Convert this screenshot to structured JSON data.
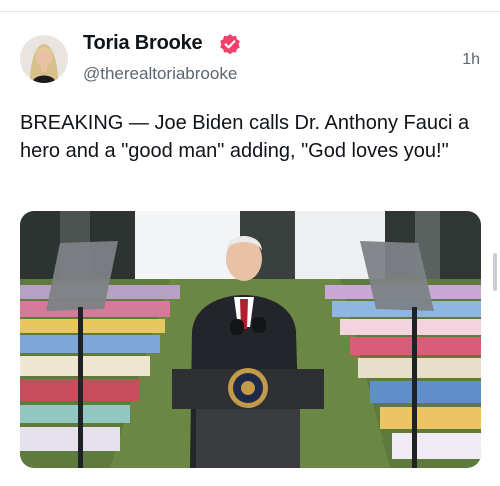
{
  "post": {
    "author_name": "Toria Brooke",
    "handle": "@therealtoriabrooke",
    "timestamp": "1h",
    "text": "BREAKING — Joe Biden calls Dr. Anthony Fauci a hero and a \"good man\" adding, \"God loves you!\"",
    "avatar_icon": "profile-photo",
    "verified_icon": "verified-badge-icon",
    "verified_color": "#f0416c",
    "media_icon": "photo-podium-speaker-outdoor"
  },
  "colors": {
    "text": "#0f1419",
    "muted": "#5b6670",
    "divider": "#e6e8ea"
  }
}
